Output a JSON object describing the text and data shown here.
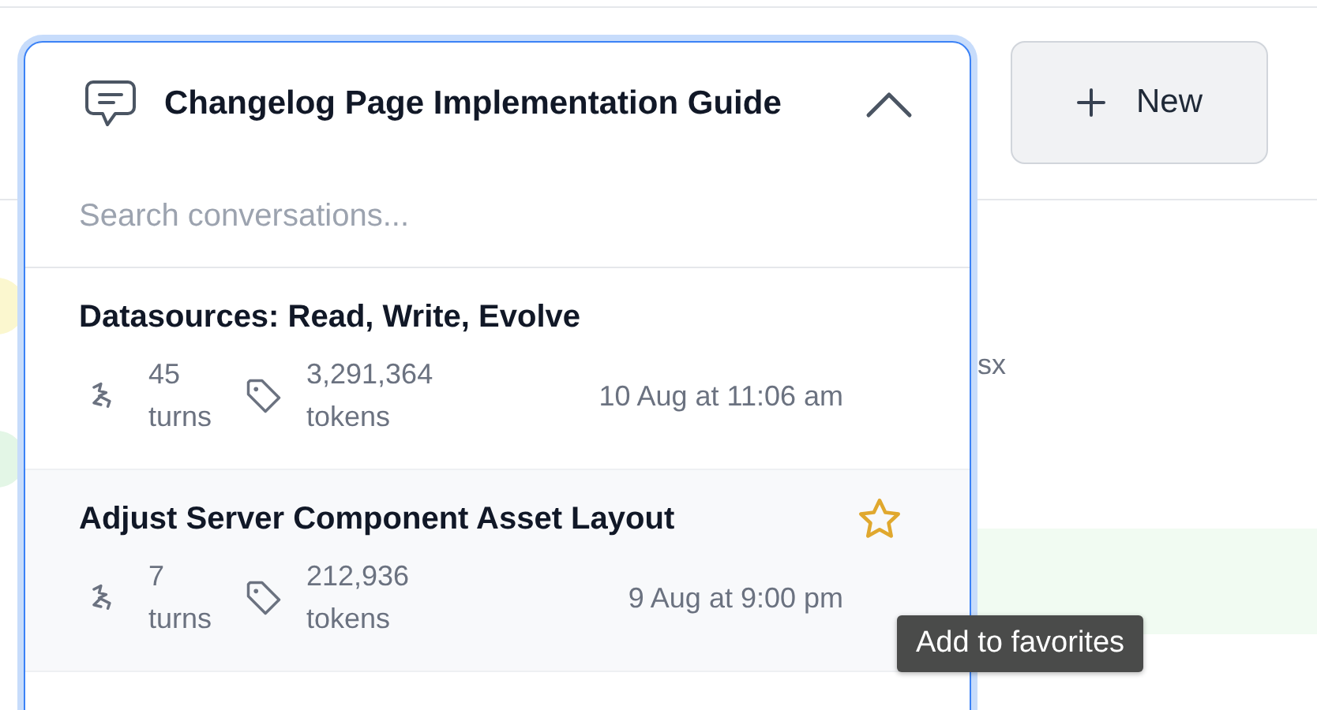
{
  "conversation_picker": {
    "title": "Changelog Page Implementation Guide",
    "expanded": true,
    "search": {
      "placeholder": "Search conversations..."
    },
    "items": [
      {
        "title": "Datasources: Read, Write, Evolve",
        "turns": "45 turns",
        "tokens": "3,291,364 tokens",
        "date": "10 Aug at 11:06 am",
        "hovered": false
      },
      {
        "title": "Adjust Server Component Asset Layout",
        "turns": "7 turns",
        "tokens": "212,936 tokens",
        "date": "9 Aug at 9:00 pm",
        "hovered": true
      }
    ]
  },
  "new_button": {
    "label": "New"
  },
  "background_text": "sx",
  "tooltip": "Add to favorites"
}
